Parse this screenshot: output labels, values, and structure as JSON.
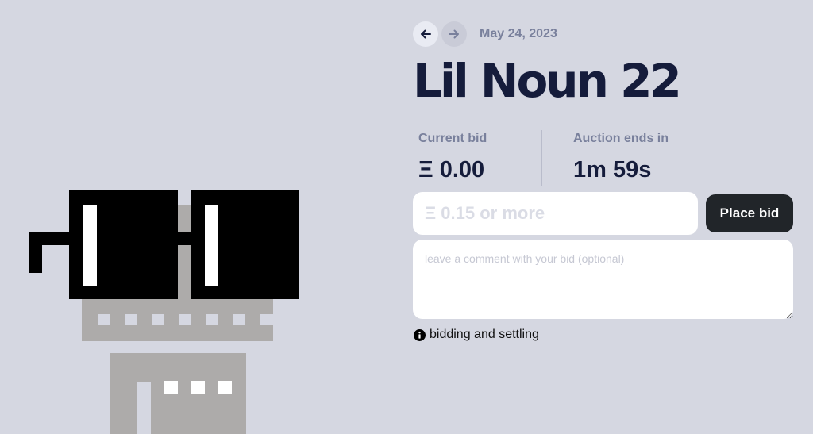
{
  "auction": {
    "date": "May 24, 2023",
    "title": "Lil Noun 22",
    "current_bid_label": "Current bid",
    "current_bid_value": "Ξ 0.00",
    "ends_label": "Auction ends in",
    "ends_value": "1m 59s"
  },
  "bid_form": {
    "amount_placeholder": "Ξ 0.15 or more",
    "place_bid_label": "Place bid",
    "comment_placeholder": "leave a comment with your bid (optional)"
  },
  "help": {
    "label": "bidding and settling"
  },
  "icons": {
    "prev": "arrow-left-icon",
    "next": "arrow-right-icon",
    "info": "info-circle-icon"
  },
  "colors": {
    "background": "#d5d7e1",
    "title": "#151c3b",
    "muted": "#79809c",
    "button": "#212529",
    "noun_body": "#adabaa",
    "glasses": "#000000"
  }
}
